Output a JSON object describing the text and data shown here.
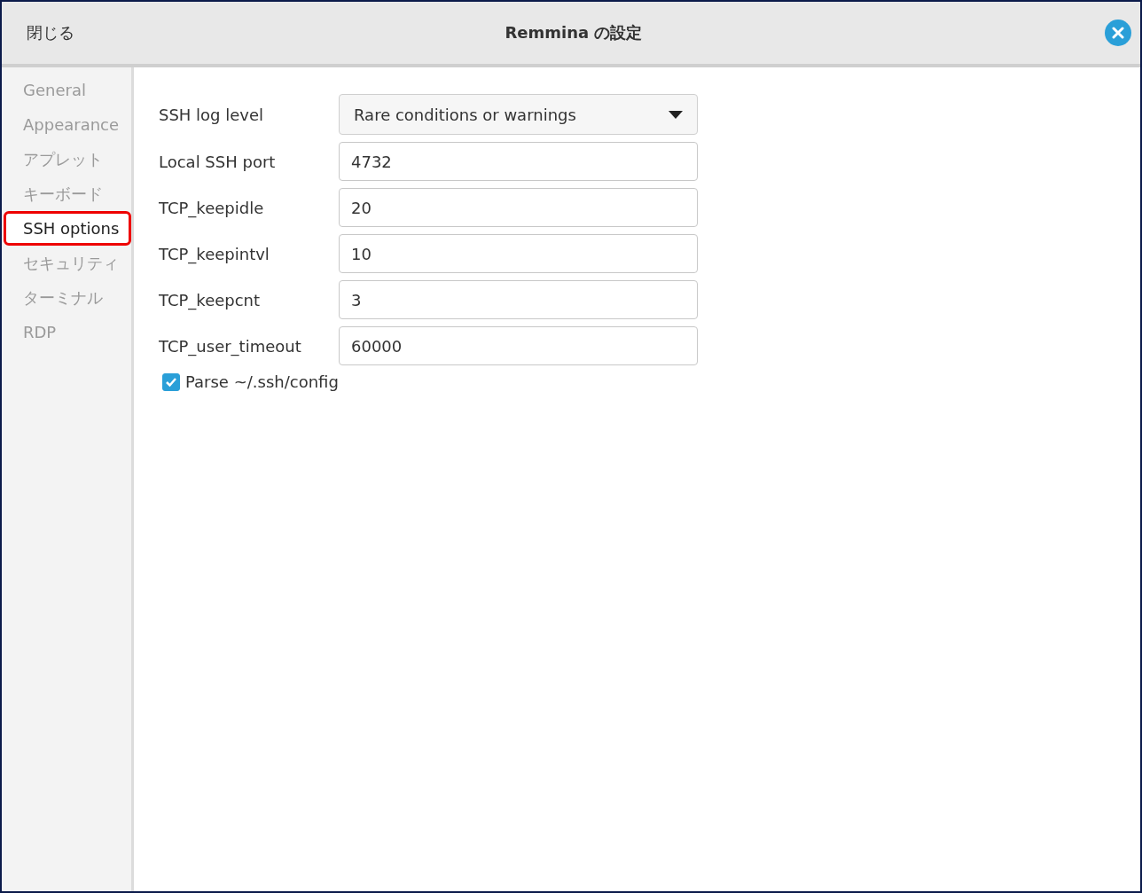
{
  "header": {
    "close_label": "閉じる",
    "title": "Remmina の設定"
  },
  "sidebar": {
    "items": [
      {
        "label": "General",
        "selected": false
      },
      {
        "label": "Appearance",
        "selected": false
      },
      {
        "label": "アプレット",
        "selected": false
      },
      {
        "label": "キーボード",
        "selected": false
      },
      {
        "label": "SSH options",
        "selected": true
      },
      {
        "label": "セキュリティ",
        "selected": false
      },
      {
        "label": "ターミナル",
        "selected": false
      },
      {
        "label": "RDP",
        "selected": false
      }
    ]
  },
  "form": {
    "rows": [
      {
        "kind": "dropdown",
        "label": "SSH log level",
        "value": "Rare conditions or warnings"
      },
      {
        "kind": "text",
        "label": "Local SSH port",
        "value": "4732"
      },
      {
        "kind": "text",
        "label": "TCP_keepidle",
        "value": "20"
      },
      {
        "kind": "text",
        "label": "TCP_keepintvl",
        "value": "10"
      },
      {
        "kind": "text",
        "label": "TCP_keepcnt",
        "value": "3"
      },
      {
        "kind": "text",
        "label": "TCP_user_timeout",
        "value": "60000"
      }
    ],
    "checkbox": {
      "label": "Parse ~/.ssh/config",
      "checked": true
    }
  }
}
